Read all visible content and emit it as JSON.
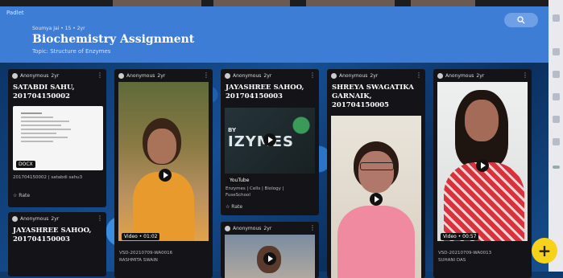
{
  "app": {
    "brand": "Padlet"
  },
  "header": {
    "meta": "Soumya Jai • 15 • 2yr",
    "title": "Biochemistry Assignment",
    "topic": "Topic: Structure of Enzymes"
  },
  "icons": {
    "search": "search-icon",
    "add": "plus-icon"
  },
  "colors": {
    "header": "#3d7dd6",
    "fab": "#f6d21b",
    "card": "#141418"
  },
  "cards": [
    {
      "author": "Anonymous",
      "age": "2yr",
      "title_lines": [
        "SATABDI SAHU,",
        "201704150002"
      ],
      "attachment_type": "DOCX",
      "caption": "201704150002 | satabdi sahu3",
      "rate_label": "Rate"
    },
    {
      "author": "Anonymous",
      "age": "2yr",
      "title_lines": [
        "JAYASHREE SAHOO,",
        "201704150003"
      ]
    },
    {
      "author": "Anonymous",
      "age": "2yr",
      "video_label": "Video • 01:02",
      "caption_lines": [
        "VSD-20210709-WA0016",
        "RASHMITA SWAIN"
      ]
    },
    {
      "author": "Anonymous",
      "age": "2yr",
      "title_lines": [
        "JAYASHREE SAHOO,",
        "201704150003"
      ],
      "thumb_text": "IZYMES",
      "thumb_prefix": "BY",
      "source_label": "YouTube",
      "caption_lines": [
        "Enzymes | Cells | Biology |",
        "FuseSchool"
      ],
      "rate_label": "Rate"
    },
    {
      "author": "Anonymous",
      "age": "2yr"
    },
    {
      "author": "Anonymous",
      "age": "2yr",
      "title_lines": [
        "SHREYA SWAGATIKA",
        "GARNAIK,",
        "201704150005"
      ]
    },
    {
      "author": "Anonymous",
      "age": "2yr",
      "video_label": "Video • 00:57",
      "caption_lines": [
        "VSD-20210709-WA0013",
        "SUHANI DAS"
      ]
    }
  ]
}
